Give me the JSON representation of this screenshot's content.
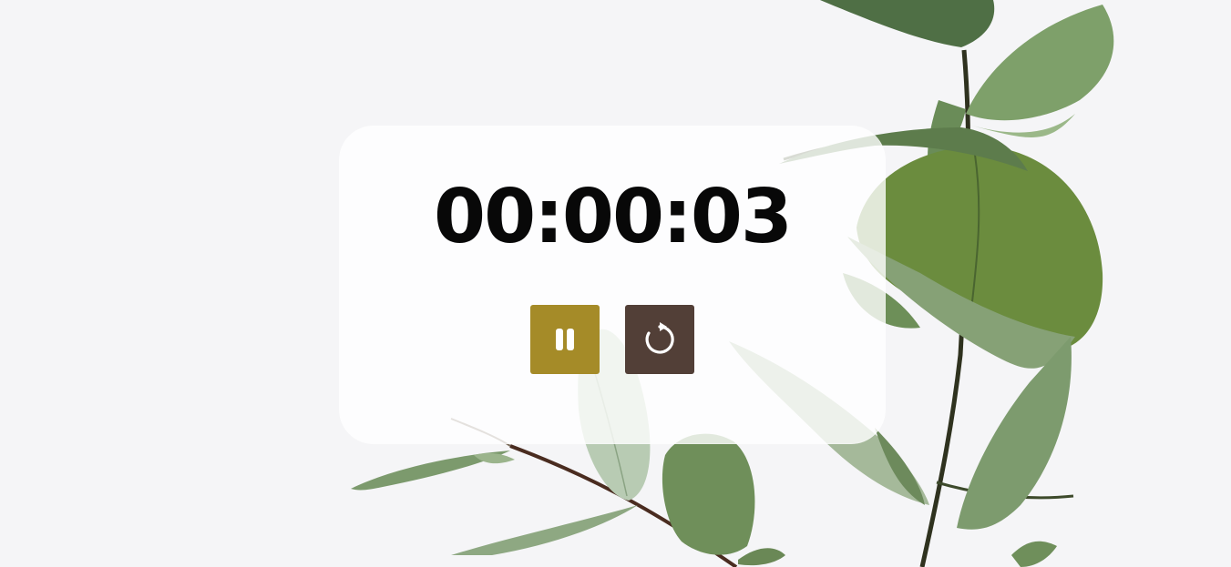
{
  "timer": {
    "display": "00:00:03"
  },
  "controls": {
    "pause": {
      "icon": "pause-icon",
      "color": "#a58b28"
    },
    "reset": {
      "icon": "reset-icon",
      "color": "#523f37"
    }
  },
  "background": {
    "color": "#f5f5f7",
    "image": "eucalyptus-branches"
  }
}
